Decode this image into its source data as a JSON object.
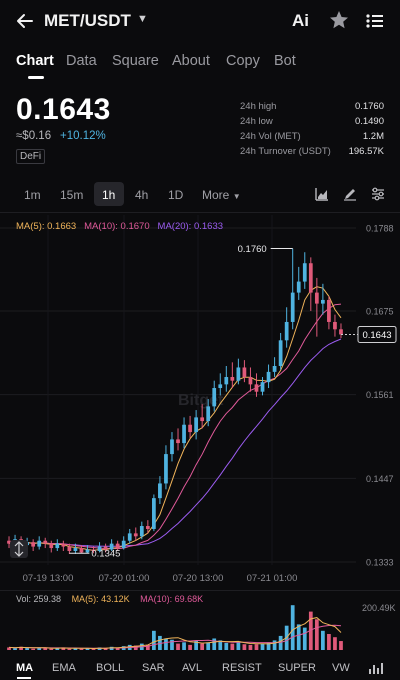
{
  "header": {
    "pair": "MET/USDT",
    "ai_label": "Ai"
  },
  "tabs": [
    {
      "label": "Chart",
      "active": true
    },
    {
      "label": "Data"
    },
    {
      "label": "Square"
    },
    {
      "label": "About"
    },
    {
      "label": "Copy"
    },
    {
      "label": "Bot"
    }
  ],
  "ticker": {
    "price": "0.1643",
    "fiat": "≈$0.16",
    "change": "+10.12%",
    "tag": "DeFi",
    "stats": [
      {
        "label": "24h high",
        "value": "0.1760"
      },
      {
        "label": "24h low",
        "value": "0.1490"
      },
      {
        "label": "24h Vol (MET)",
        "value": "1.2M"
      },
      {
        "label": "24h Turnover (USDT)",
        "value": "196.57K"
      }
    ]
  },
  "intervals": {
    "items": [
      "1m",
      "15m",
      "1h",
      "4h",
      "1D"
    ],
    "active": "1h",
    "more_label": "More"
  },
  "ma_legend": {
    "ma5": "MA(5): 0.1663",
    "ma10": "MA(10): 0.1670",
    "ma20": "MA(20): 0.1633"
  },
  "colors": {
    "up": "#4fb3e0",
    "down": "#e05a7a",
    "ma5": "#f0b45a",
    "ma10": "#e05a9a",
    "ma20": "#9b5cf0"
  },
  "chart_data": {
    "type": "candlestick",
    "price_axis_labels": [
      "0.1788",
      "0.1675",
      "0.1561",
      "0.1447",
      "0.1333"
    ],
    "time_axis_labels": [
      "07-19 13:00",
      "07-20 01:00",
      "07-20 13:00",
      "07-21 01:00"
    ],
    "high_marker": "0.1760",
    "low_marker": "0.1345",
    "last_price_label": "0.1643",
    "watermark": "Bitget",
    "candles": [
      [
        0.1362,
        0.1358,
        0.1368,
        0.1352
      ],
      [
        0.1358,
        0.1364,
        0.137,
        0.1352
      ],
      [
        0.1364,
        0.1356,
        0.1368,
        0.135
      ],
      [
        0.1356,
        0.136,
        0.1366,
        0.135
      ],
      [
        0.136,
        0.1354,
        0.1364,
        0.1348
      ],
      [
        0.1354,
        0.1362,
        0.1368,
        0.135
      ],
      [
        0.1362,
        0.1358,
        0.1366,
        0.1352
      ],
      [
        0.1358,
        0.1352,
        0.1362,
        0.1346
      ],
      [
        0.1352,
        0.1358,
        0.1364,
        0.1348
      ],
      [
        0.1358,
        0.1354,
        0.1362,
        0.1348
      ],
      [
        0.1354,
        0.1348,
        0.1358,
        0.1344
      ],
      [
        0.1348,
        0.1352,
        0.1358,
        0.1344
      ],
      [
        0.1352,
        0.1346,
        0.1356,
        0.1345
      ],
      [
        0.1346,
        0.135,
        0.1356,
        0.1345
      ],
      [
        0.135,
        0.1348,
        0.1354,
        0.1345
      ],
      [
        0.1348,
        0.1354,
        0.136,
        0.1346
      ],
      [
        0.1354,
        0.135,
        0.1358,
        0.1346
      ],
      [
        0.135,
        0.1358,
        0.1364,
        0.1348
      ],
      [
        0.1358,
        0.1352,
        0.1362,
        0.1348
      ],
      [
        0.1352,
        0.1362,
        0.1368,
        0.135
      ],
      [
        0.1362,
        0.1372,
        0.1378,
        0.1358
      ],
      [
        0.1372,
        0.1368,
        0.138,
        0.1362
      ],
      [
        0.1368,
        0.1382,
        0.1388,
        0.1364
      ],
      [
        0.1382,
        0.1378,
        0.139,
        0.1372
      ],
      [
        0.1378,
        0.142,
        0.1425,
        0.1375
      ],
      [
        0.142,
        0.144,
        0.145,
        0.1412
      ],
      [
        0.144,
        0.148,
        0.1492,
        0.1432
      ],
      [
        0.148,
        0.15,
        0.151,
        0.147
      ],
      [
        0.15,
        0.1495,
        0.1515,
        0.1485
      ],
      [
        0.1495,
        0.152,
        0.153,
        0.1488
      ],
      [
        0.152,
        0.151,
        0.1532,
        0.1502
      ],
      [
        0.151,
        0.153,
        0.154,
        0.15
      ],
      [
        0.153,
        0.1525,
        0.1548,
        0.1515
      ],
      [
        0.1525,
        0.1545,
        0.1555,
        0.1518
      ],
      [
        0.1545,
        0.157,
        0.158,
        0.1538
      ],
      [
        0.157,
        0.1575,
        0.159,
        0.156
      ],
      [
        0.1575,
        0.1585,
        0.16,
        0.1565
      ],
      [
        0.1585,
        0.158,
        0.1605,
        0.157
      ],
      [
        0.158,
        0.1598,
        0.161,
        0.1575
      ],
      [
        0.1598,
        0.1585,
        0.1608,
        0.1578
      ],
      [
        0.1585,
        0.1575,
        0.1598,
        0.1565
      ],
      [
        0.1575,
        0.1565,
        0.159,
        0.1558
      ],
      [
        0.1565,
        0.1578,
        0.1585,
        0.156
      ],
      [
        0.1578,
        0.1592,
        0.1602,
        0.157
      ],
      [
        0.1592,
        0.16,
        0.1612,
        0.1585
      ],
      [
        0.16,
        0.1635,
        0.1645,
        0.1595
      ],
      [
        0.1635,
        0.166,
        0.168,
        0.1625
      ],
      [
        0.166,
        0.17,
        0.176,
        0.165
      ],
      [
        0.17,
        0.1715,
        0.1735,
        0.169
      ],
      [
        0.1715,
        0.174,
        0.1755,
        0.1705
      ],
      [
        0.174,
        0.17,
        0.1748,
        0.1675
      ],
      [
        0.17,
        0.1685,
        0.172,
        0.164
      ],
      [
        0.1685,
        0.169,
        0.1712,
        0.167
      ],
      [
        0.169,
        0.166,
        0.1695,
        0.165
      ],
      [
        0.166,
        0.165,
        0.167,
        0.164
      ],
      [
        0.165,
        0.1643,
        0.1658,
        0.1638
      ]
    ]
  },
  "volume": {
    "label": "Vol: 259.38",
    "ma5": "MA(5): 43.12K",
    "ma10": "MA(10): 69.68K",
    "axis_top": "200.49K",
    "bars": [
      4,
      3,
      5,
      3,
      2,
      4,
      3,
      2,
      3,
      4,
      2,
      3,
      2,
      3,
      2,
      4,
      3,
      5,
      3,
      6,
      8,
      7,
      10,
      8,
      30,
      22,
      18,
      16,
      10,
      12,
      8,
      14,
      10,
      12,
      18,
      15,
      11,
      10,
      13,
      9,
      8,
      9,
      10,
      12,
      15,
      22,
      38,
      70,
      40,
      35,
      60,
      48,
      30,
      25,
      20,
      14
    ]
  },
  "indicators": {
    "items": [
      "MA",
      "EMA",
      "BOLL",
      "SAR",
      "AVL",
      "RESIST",
      "SUPER",
      "VW"
    ],
    "active": "MA"
  }
}
